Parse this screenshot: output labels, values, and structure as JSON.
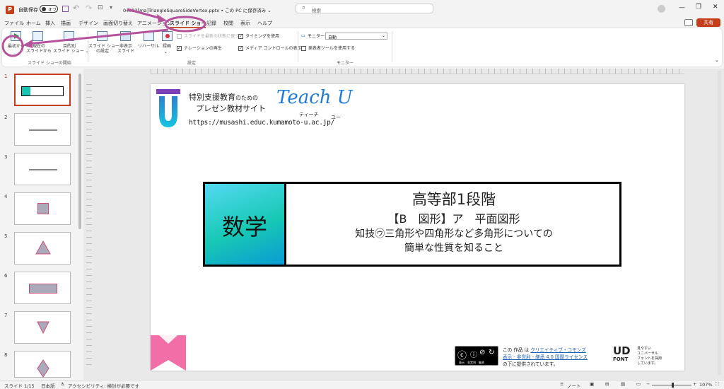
{
  "titlebar": {
    "autosave_label": "自動保存",
    "autosave_state": "オフ",
    "filename": "04032[ma]TriangleSquareSideVertex.pptx • この PC に保存済み ⌄",
    "search_placeholder": "検索"
  },
  "tabs": [
    "ファイル",
    "ホーム",
    "挿入",
    "描画",
    "デザイン",
    "画面切り替え",
    "アニメーション",
    "スライド ショー",
    "記録",
    "校閲",
    "表示",
    "ヘルプ"
  ],
  "active_tab": "スライド ショー",
  "share_label": "共有",
  "ribbon": {
    "from_start": "最初から",
    "from_current": "現在の\nスライドから",
    "custom": "目的別\nスライド ショー ⌄",
    "group_start": "スライド ショーの開始",
    "setup": "スライド ショー\nの設定",
    "hide": "非表示\nスライド",
    "rehearse": "リハーサル",
    "record": "録画",
    "keep_fresh": "スライドを最新の状態に保つ",
    "narrations": "ナレーションの再生",
    "timings": "タイミングを使用",
    "media_controls": "メディア コントロールの表示",
    "group_setup": "設定",
    "monitor_label": "モニター:",
    "monitor_value": "自動",
    "presenter_view": "発表者ツールを使用する",
    "group_monitors": "モニター"
  },
  "slides": [
    {
      "n": "1"
    },
    {
      "n": "2"
    },
    {
      "n": "3"
    },
    {
      "n": "4"
    },
    {
      "n": "5"
    },
    {
      "n": "6"
    },
    {
      "n": "7"
    },
    {
      "n": "8"
    }
  ],
  "slide": {
    "header_line1": "特別支援教育",
    "header_line1_small": "のための",
    "header_line2": "プレゼン教材サイト",
    "teachu": "Teach U",
    "teachu_ruby1": "ティーチ",
    "teachu_ruby2": "ユー",
    "url": "https://musashi.educ.kumamoto-u.ac.jp/",
    "subject": "数学",
    "title1": "高等部1段階",
    "title2": "【B　図形】ア　平面図形",
    "title3": "知技㋒三角形や四角形など多角形についての",
    "title4": "簡単な性質を知ること",
    "cc_text1": "この 作品 は",
    "cc_link1": "クリエイティブ・コモンズ",
    "cc_link2": "表示 - 非営利 - 継承 4.0 国際ライセンス",
    "cc_text2": "の下に提供されています。",
    "cc_badge_small": "表示　非営利　継承",
    "ud_line1": "UD",
    "ud_line2": "FONT",
    "ud_desc": "見やすい\nユニバーサル\nフォントを採用\nしています。"
  },
  "status": {
    "slide_count": "スライド 1/15",
    "language": "日本語",
    "accessibility": "アクセシビリティ: 検討が必要です",
    "notes": "ノート",
    "zoom": "107%"
  },
  "colors": {
    "accent": "#c43e1c",
    "annotation": "#b5529c",
    "teal_start": "#17c3b2",
    "teal_end": "#0aa0d8"
  }
}
